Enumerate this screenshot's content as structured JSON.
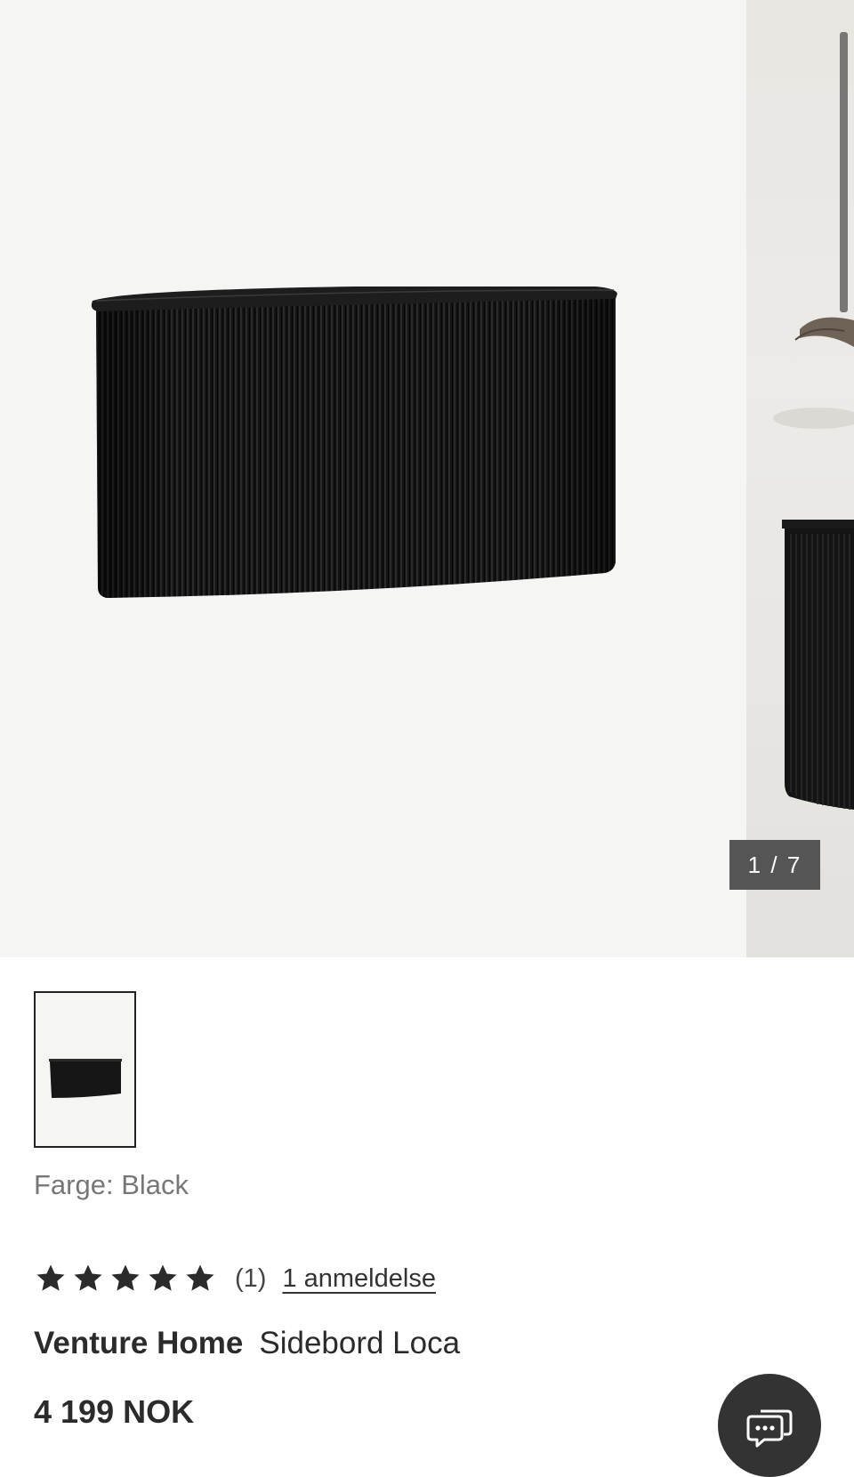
{
  "gallery": {
    "counter_current": "1",
    "counter_separator": "/",
    "counter_total": "7"
  },
  "product": {
    "color_label": "Farge:",
    "color_value": "Black",
    "rating_stars": 5,
    "rating_count": "(1)",
    "review_link": "1 anmeldelse",
    "brand": "Venture Home",
    "name": "Sidebord Loca",
    "price": "4 199 NOK"
  },
  "icons": {
    "gallery_image": "product-image",
    "star": "star-icon",
    "chat": "chat-icon"
  },
  "colors": {
    "gallery_background": "#f5f5f4",
    "product": "#111111",
    "counter_background": "#555555",
    "chat_button": "#333333",
    "text": "#2b2b2b",
    "muted_text": "#777777"
  }
}
